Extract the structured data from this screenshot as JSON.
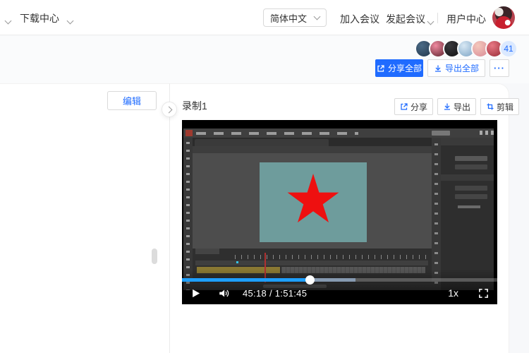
{
  "header": {
    "nav_title": "下载中心",
    "language": "简体中文",
    "join_meeting": "加入会议",
    "start_meeting": "发起会议",
    "user_center": "用户中心"
  },
  "share_bar": {
    "participant_count": "41",
    "share_all_label": "分享全部",
    "export_all_label": "导出全部",
    "more_label": "···",
    "avatars": [
      {
        "name": "participant-avatar-1",
        "color1": "#4a6a86",
        "color2": "#22364a"
      },
      {
        "name": "participant-avatar-2",
        "color1": "#f08aa0",
        "color2": "#5a1f2a"
      },
      {
        "name": "participant-avatar-3",
        "color1": "#3a3a3e",
        "color2": "#101012"
      },
      {
        "name": "participant-avatar-4",
        "color1": "#d8e8f4",
        "color2": "#7ba3c4"
      },
      {
        "name": "participant-avatar-5",
        "color1": "#f4c8bc",
        "color2": "#d88a96"
      },
      {
        "name": "participant-avatar-6",
        "color1": "#e87884",
        "color2": "#962a35"
      }
    ]
  },
  "sidebar": {
    "edit_label": "编辑"
  },
  "recording": {
    "title": "录制1",
    "share_label": "分享",
    "export_label": "导出",
    "clip_label": "剪辑"
  },
  "player": {
    "time_display": "45:18 / 1:51:45",
    "speed_label": "1x",
    "progress_percent": 40.5,
    "buffered_percent": 55
  },
  "colors": {
    "accent": "#1f6bff",
    "progress_blue": "#1e9fff",
    "badge_bg": "#dbe9ff",
    "stage_teal": "#6e9c9c",
    "star_red": "#ee1010",
    "timeline_olive": "#8a7933"
  }
}
